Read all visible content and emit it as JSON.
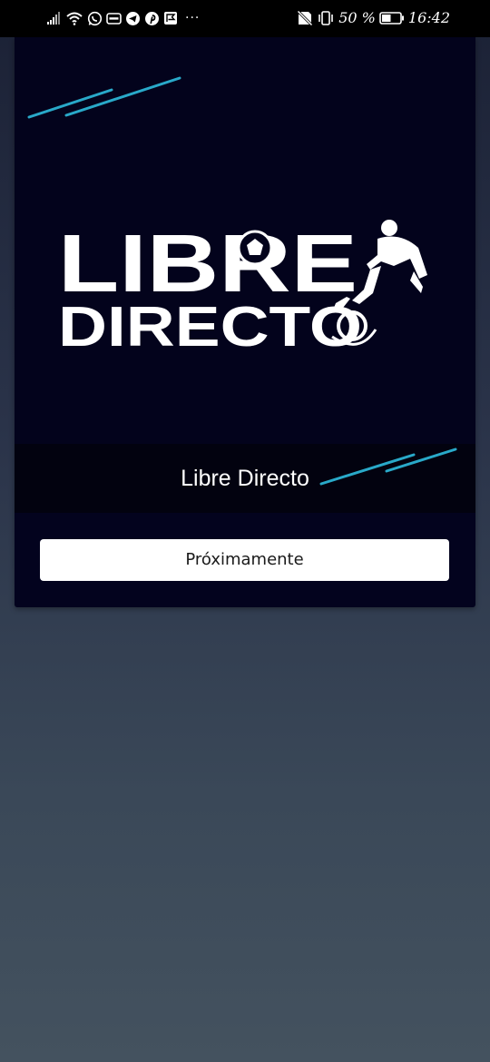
{
  "status_bar": {
    "left_icons": [
      "signal-icon",
      "wifi-icon",
      "whatsapp-icon",
      "wallet-icon",
      "telegram-icon",
      "pinterest-icon",
      "flag-icon"
    ],
    "more_indicator": "···",
    "right_icons": [
      "no-sim-icon",
      "vibrate-icon",
      "battery-icon"
    ],
    "battery_percent": "50 %",
    "battery_level": 0.5,
    "time": "16:42"
  },
  "card": {
    "logo_line1": "LIBRE",
    "logo_line2": "DIRECTO",
    "title": "Libre Directo",
    "button_label": "Próximamente"
  },
  "colors": {
    "card_background": "#03031e",
    "title_strip_background": "#02020f",
    "accent_cyan": "#29a9c9",
    "button_background": "#ffffff",
    "button_text": "#1a1a1a",
    "page_gradient_top": "#1b2135",
    "page_gradient_bottom": "#44525f"
  }
}
